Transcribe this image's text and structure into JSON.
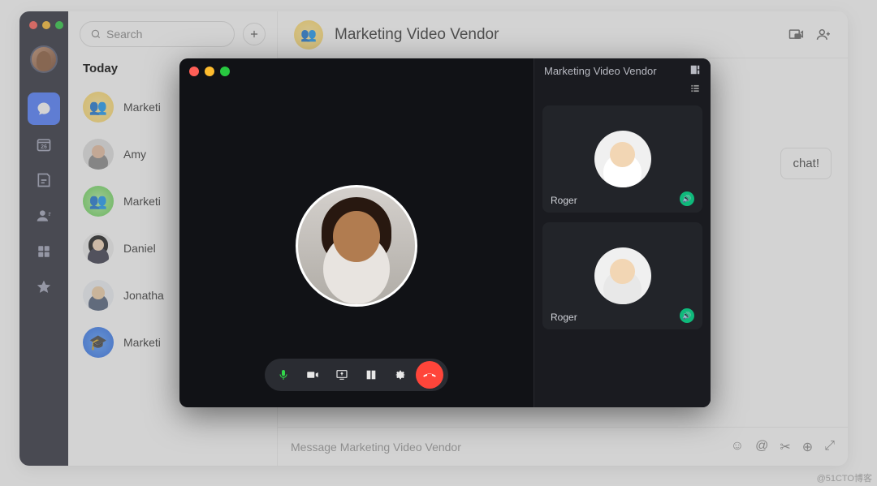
{
  "rail": {
    "calendar_day": "26"
  },
  "search": {
    "placeholder": "Search"
  },
  "chatlist": {
    "section": "Today",
    "items": [
      {
        "label": "Marketi"
      },
      {
        "label": "Amy"
      },
      {
        "label": "Marketi"
      },
      {
        "label": "Daniel"
      },
      {
        "label": "Jonatha"
      },
      {
        "label": "Marketi"
      }
    ]
  },
  "conversation": {
    "title": "Marketing Video Vendor",
    "bubble_text": "chat!",
    "composer_placeholder": "Message Marketing Video Vendor"
  },
  "call": {
    "title": "Marketing Video Vendor",
    "participants": [
      {
        "name": "Roger"
      },
      {
        "name": "Roger"
      }
    ]
  },
  "watermark": "@51CTO博客"
}
